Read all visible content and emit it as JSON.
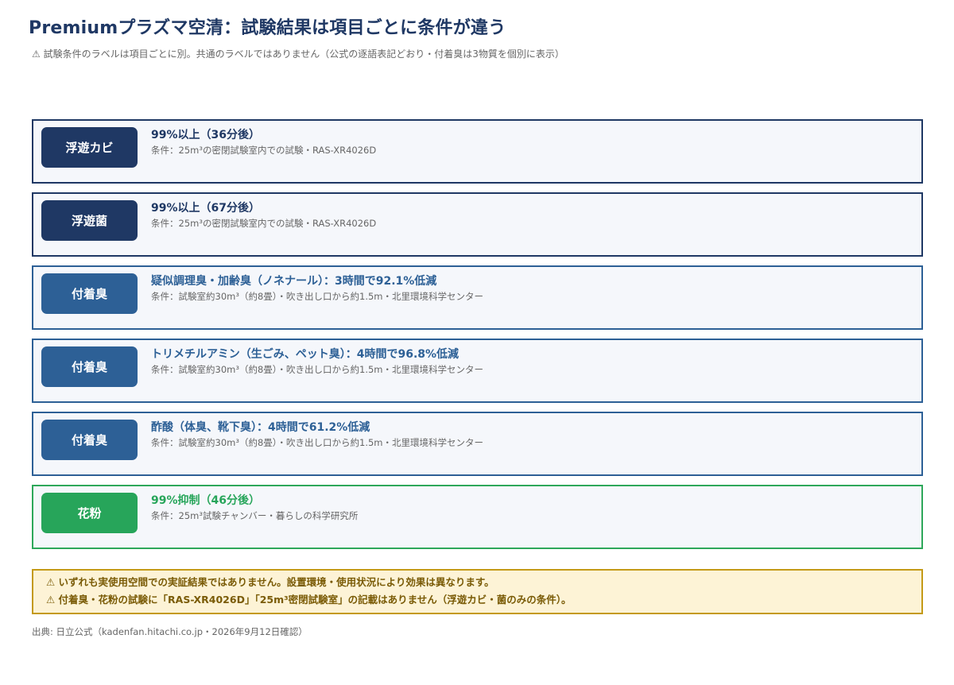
{
  "header": {
    "title": "Premiumプラズマ空清：試験結果は項目ごとに条件が違う",
    "subtitle": "⚠ 試験条件のラベルは項目ごとに別。共通のラベルではありません（公式の逐語表記どおり・付着臭は3物質を個別に表示）"
  },
  "items": [
    {
      "badge": "浮遊カビ",
      "result": "99%以上（36分後）",
      "condition": "条件：25m³の密閉試験室内での試験・RAS-XR4026D",
      "color": "#1f3864"
    },
    {
      "badge": "浮遊菌",
      "result": "99%以上（67分後）",
      "condition": "条件：25m³の密閉試験室内での試験・RAS-XR4026D",
      "color": "#1f3864"
    },
    {
      "badge": "付着臭",
      "result": "疑似調理臭・加齢臭（ノネナール）：3時間で92.1%低減",
      "condition": "条件：試験室約30m³（約8畳）・吹き出し口から約1.5m・北里環境科学センター",
      "color": "#2d6096"
    },
    {
      "badge": "付着臭",
      "result": "トリメチルアミン（生ごみ、ペット臭）：4時間で96.8%低減",
      "condition": "条件：試験室約30m³（約8畳）・吹き出し口から約1.5m・北里環境科学センター",
      "color": "#2d6096"
    },
    {
      "badge": "付着臭",
      "result": "酢酸（体臭、靴下臭）：4時間で61.2%低減",
      "condition": "条件：試験室約30m³（約8畳）・吹き出し口から約1.5m・北里環境科学センター",
      "color": "#2d6096"
    },
    {
      "badge": "花粉",
      "result": "99%抑制（46分後）",
      "condition": "条件：25m³試験チャンバー・暮らしの科学研究所",
      "color": "#27a55a"
    }
  ],
  "notice": {
    "line1": "⚠ いずれも実使用空間での実証結果ではありません。設置環境・使用状況により効果は異なります。",
    "line2": "⚠ 付着臭・花粉の試験に「RAS-XR4026D」「25m³密閉試験室」の記載はありません（浮遊カビ・菌のみの条件）。",
    "border_color": "#c49a17",
    "background": "#fdf3d6"
  },
  "source": "出典: 日立公式（kadenfan.hitachi.co.jp・2026年9月12日確認）"
}
